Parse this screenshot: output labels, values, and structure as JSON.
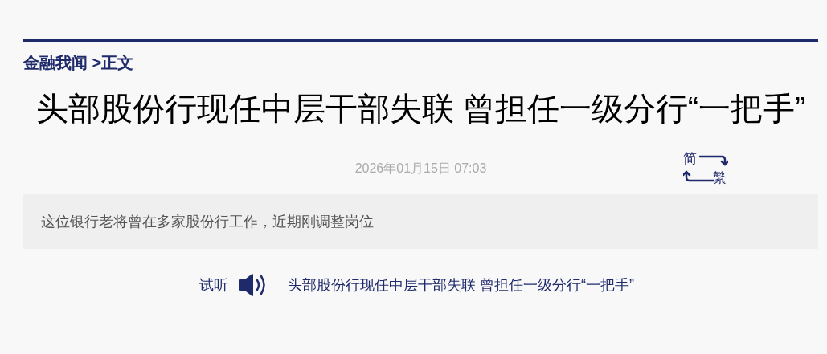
{
  "breadcrumb": "金融我闻 >正文",
  "article": {
    "title": "头部股份行现任中层干部失联 曾担任一级分行“一把手”",
    "date": "2026年01月15日 07:03",
    "script_toggle": {
      "simplified": "简",
      "traditional": "繁"
    },
    "summary": "这位银行老将曾在多家股份行工作，近期刚调整岗位",
    "audio": {
      "label": "试听",
      "title": "头部股份行现任中层干部失联 曾担任一级分行“一把手”"
    }
  }
}
